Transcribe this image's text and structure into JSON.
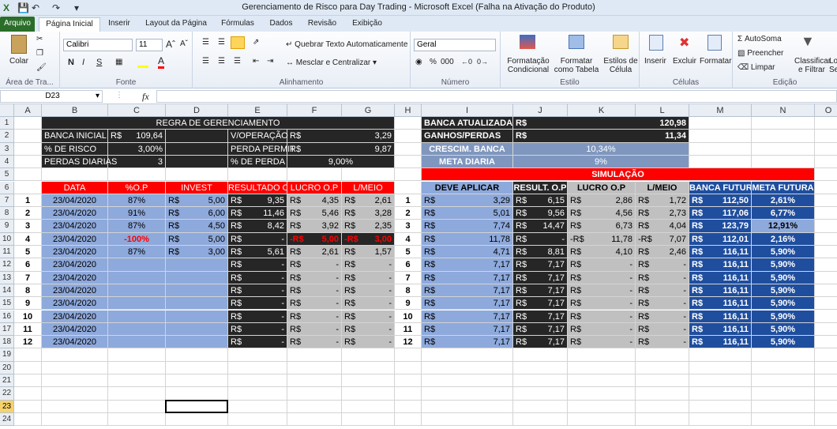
{
  "window": {
    "title": "Gerenciamento de Risco para Day Trading  -  Microsoft Excel (Falha na Ativação do Produto)"
  },
  "tabs": [
    "Arquivo",
    "Página Inicial",
    "Inserir",
    "Layout da Página",
    "Fórmulas",
    "Dados",
    "Revisão",
    "Exibição"
  ],
  "ribbon": {
    "clipboard": {
      "paste": "Colar",
      "label": "Área de Tra..."
    },
    "font": {
      "name": "Calibri",
      "size": "11",
      "bold": "N",
      "italic": "I",
      "underline": "S",
      "label": "Fonte"
    },
    "alignment": {
      "wrap": "Quebrar Texto Automaticamente",
      "merge": "Mesclar e Centralizar",
      "label": "Alinhamento"
    },
    "number": {
      "format": "Geral",
      "label": "Número"
    },
    "styles": {
      "conditional": "Formatação Condicional",
      "table": "Formatar como Tabela",
      "cell": "Estilos de Célula",
      "label": "Estilo"
    },
    "cells": {
      "insert": "Inserir",
      "delete": "Excluir",
      "format": "Formatar",
      "label": "Células"
    },
    "editing": {
      "autosum": "AutoSoma",
      "fill": "Preencher",
      "clear": "Limpar",
      "sort": "Classificar e Filtrar",
      "find": "Lo Se",
      "label": "Edição"
    }
  },
  "formula_bar": {
    "name_box": "D23",
    "fx": "fx",
    "value": ""
  },
  "columns": [
    "A",
    "B",
    "C",
    "D",
    "E",
    "F",
    "G",
    "H",
    "I",
    "J",
    "K",
    "L",
    "M",
    "N",
    "O"
  ],
  "rows": [
    "1",
    "2",
    "3",
    "4",
    "5",
    "6",
    "7",
    "8",
    "9",
    "10",
    "11",
    "12",
    "13",
    "14",
    "15",
    "16",
    "17",
    "18",
    "19",
    "20",
    "21",
    "22",
    "23",
    "24"
  ],
  "left_panel": {
    "title": "REGRA DE GERENCIAMENTO",
    "banca_inicial_label": "BANCA INICIAL",
    "banca_inicial_cur": "R$",
    "banca_inicial_val": "109,64",
    "risco_label": "% DE RISCO",
    "risco_val": "3,00%",
    "perdas_label": "PERDAS DIARIAS",
    "perdas_val": "3",
    "voperacao_label": "V/OPERAÇÃO",
    "voperacao_cur": "R$",
    "voperacao_val": "3,29",
    "perda_permit_label": "PERDA PERMIT",
    "perda_permit_cur": "R$",
    "perda_permit_val": "9,87",
    "pct_perda_label": "% DE PERDA",
    "pct_perda_val": "9,00%"
  },
  "right_panel": {
    "banca_atual_label": "BANCA ATUALIZADA",
    "banca_atual_cur": "R$",
    "banca_atual_val": "120,98",
    "ganhos_label": "GANHOS/PERDAS",
    "ganhos_cur": "R$",
    "ganhos_val": "11,34",
    "crescim_label": "CRESCIM. BANCA",
    "crescim_val": "10,34%",
    "meta_label": "META DIARIA",
    "meta_val": "9%",
    "simulacao_label": "SIMULAÇÃO"
  },
  "left_table": {
    "headers": [
      "DATA",
      "%O.P",
      "INVEST",
      "RESULTADO O.P",
      "LUCRO O.P",
      "L/MEIO"
    ],
    "rows": [
      {
        "n": "1",
        "data": "23/04/2020",
        "op": "87%",
        "inv_cur": "R$",
        "inv": "5,00",
        "res_cur": "R$",
        "res": "9,35",
        "luc_cur": "R$",
        "luc": "4,35",
        "mei_cur": "R$",
        "mei": "2,61"
      },
      {
        "n": "2",
        "data": "23/04/2020",
        "op": "91%",
        "inv_cur": "R$",
        "inv": "6,00",
        "res_cur": "R$",
        "res": "11,46",
        "luc_cur": "R$",
        "luc": "5,46",
        "mei_cur": "R$",
        "mei": "3,28"
      },
      {
        "n": "3",
        "data": "23/04/2020",
        "op": "87%",
        "inv_cur": "R$",
        "inv": "4,50",
        "res_cur": "R$",
        "res": "8,42",
        "luc_cur": "R$",
        "luc": "3,92",
        "mei_cur": "R$",
        "mei": "2,35"
      },
      {
        "n": "4",
        "data": "23/04/2020",
        "op": "-100%",
        "inv_cur": "R$",
        "inv": "5,00",
        "res_cur": "R$",
        "res": "-",
        "luc_cur": "-R$",
        "luc": "5,00",
        "mei_cur": "-R$",
        "mei": "3,00"
      },
      {
        "n": "5",
        "data": "23/04/2020",
        "op": "87%",
        "inv_cur": "R$",
        "inv": "3,00",
        "res_cur": "R$",
        "res": "5,61",
        "luc_cur": "R$",
        "luc": "2,61",
        "mei_cur": "R$",
        "mei": "1,57"
      },
      {
        "n": "6",
        "data": "23/04/2020",
        "op": "",
        "inv_cur": "",
        "inv": "",
        "res_cur": "R$",
        "res": "-",
        "luc_cur": "R$",
        "luc": "-",
        "mei_cur": "R$",
        "mei": "-"
      },
      {
        "n": "7",
        "data": "23/04/2020",
        "op": "",
        "inv_cur": "",
        "inv": "",
        "res_cur": "R$",
        "res": "-",
        "luc_cur": "R$",
        "luc": "-",
        "mei_cur": "R$",
        "mei": "-"
      },
      {
        "n": "8",
        "data": "23/04/2020",
        "op": "",
        "inv_cur": "",
        "inv": "",
        "res_cur": "R$",
        "res": "-",
        "luc_cur": "R$",
        "luc": "-",
        "mei_cur": "R$",
        "mei": "-"
      },
      {
        "n": "9",
        "data": "23/04/2020",
        "op": "",
        "inv_cur": "",
        "inv": "",
        "res_cur": "R$",
        "res": "-",
        "luc_cur": "R$",
        "luc": "-",
        "mei_cur": "R$",
        "mei": "-"
      },
      {
        "n": "10",
        "data": "23/04/2020",
        "op": "",
        "inv_cur": "",
        "inv": "",
        "res_cur": "R$",
        "res": "-",
        "luc_cur": "R$",
        "luc": "-",
        "mei_cur": "R$",
        "mei": "-"
      },
      {
        "n": "11",
        "data": "23/04/2020",
        "op": "",
        "inv_cur": "",
        "inv": "",
        "res_cur": "R$",
        "res": "-",
        "luc_cur": "R$",
        "luc": "-",
        "mei_cur": "R$",
        "mei": "-"
      },
      {
        "n": "12",
        "data": "23/04/2020",
        "op": "",
        "inv_cur": "",
        "inv": "",
        "res_cur": "R$",
        "res": "-",
        "luc_cur": "R$",
        "luc": "-",
        "mei_cur": "R$",
        "mei": "-"
      }
    ]
  },
  "right_table": {
    "headers": [
      "DEVE APLICAR",
      "RESULT. O.P",
      "LUCRO O.P",
      "L/MEIO",
      "BANCA FUTURA",
      "META FUTURA"
    ],
    "rows": [
      {
        "n": "1",
        "dev_cur": "R$",
        "dev": "3,29",
        "res_cur": "R$",
        "res": "6,15",
        "luc_cur": "R$",
        "luc": "2,86",
        "mei_cur": "R$",
        "mei": "1,72",
        "ban_cur": "R$",
        "ban": "112,50",
        "meta": "2,61%"
      },
      {
        "n": "2",
        "dev_cur": "R$",
        "dev": "5,01",
        "res_cur": "R$",
        "res": "9,56",
        "luc_cur": "R$",
        "luc": "4,56",
        "mei_cur": "R$",
        "mei": "2,73",
        "ban_cur": "R$",
        "ban": "117,06",
        "meta": "6,77%"
      },
      {
        "n": "3",
        "dev_cur": "R$",
        "dev": "7,74",
        "res_cur": "R$",
        "res": "14,47",
        "luc_cur": "R$",
        "luc": "6,73",
        "mei_cur": "R$",
        "mei": "4,04",
        "ban_cur": "R$",
        "ban": "123,79",
        "meta": "12,91%"
      },
      {
        "n": "4",
        "dev_cur": "R$",
        "dev": "11,78",
        "res_cur": "R$",
        "res": "-",
        "luc_cur": "-R$",
        "luc": "11,78",
        "mei_cur": "-R$",
        "mei": "7,07",
        "ban_cur": "R$",
        "ban": "112,01",
        "meta": "2,16%"
      },
      {
        "n": "5",
        "dev_cur": "R$",
        "dev": "4,71",
        "res_cur": "R$",
        "res": "8,81",
        "luc_cur": "R$",
        "luc": "4,10",
        "mei_cur": "R$",
        "mei": "2,46",
        "ban_cur": "R$",
        "ban": "116,11",
        "meta": "5,90%"
      },
      {
        "n": "6",
        "dev_cur": "R$",
        "dev": "7,17",
        "res_cur": "R$",
        "res": "7,17",
        "luc_cur": "R$",
        "luc": "-",
        "mei_cur": "R$",
        "mei": "-",
        "ban_cur": "R$",
        "ban": "116,11",
        "meta": "5,90%"
      },
      {
        "n": "7",
        "dev_cur": "R$",
        "dev": "7,17",
        "res_cur": "R$",
        "res": "7,17",
        "luc_cur": "R$",
        "luc": "-",
        "mei_cur": "R$",
        "mei": "-",
        "ban_cur": "R$",
        "ban": "116,11",
        "meta": "5,90%"
      },
      {
        "n": "8",
        "dev_cur": "R$",
        "dev": "7,17",
        "res_cur": "R$",
        "res": "7,17",
        "luc_cur": "R$",
        "luc": "-",
        "mei_cur": "R$",
        "mei": "-",
        "ban_cur": "R$",
        "ban": "116,11",
        "meta": "5,90%"
      },
      {
        "n": "9",
        "dev_cur": "R$",
        "dev": "7,17",
        "res_cur": "R$",
        "res": "7,17",
        "luc_cur": "R$",
        "luc": "-",
        "mei_cur": "R$",
        "mei": "-",
        "ban_cur": "R$",
        "ban": "116,11",
        "meta": "5,90%"
      },
      {
        "n": "10",
        "dev_cur": "R$",
        "dev": "7,17",
        "res_cur": "R$",
        "res": "7,17",
        "luc_cur": "R$",
        "luc": "-",
        "mei_cur": "R$",
        "mei": "-",
        "ban_cur": "R$",
        "ban": "116,11",
        "meta": "5,90%"
      },
      {
        "n": "11",
        "dev_cur": "R$",
        "dev": "7,17",
        "res_cur": "R$",
        "res": "7,17",
        "luc_cur": "R$",
        "luc": "-",
        "mei_cur": "R$",
        "mei": "-",
        "ban_cur": "R$",
        "ban": "116,11",
        "meta": "5,90%"
      },
      {
        "n": "12",
        "dev_cur": "R$",
        "dev": "7,17",
        "res_cur": "R$",
        "res": "7,17",
        "luc_cur": "R$",
        "luc": "-",
        "mei_cur": "R$",
        "mei": "-",
        "ban_cur": "R$",
        "ban": "116,11",
        "meta": "5,90%"
      }
    ]
  },
  "icons": {
    "save": "save-icon",
    "undo": "undo-icon",
    "redo": "redo-icon",
    "sum": "Σ",
    "fx": "fx"
  },
  "colors": {
    "dark": "#262626",
    "gray": "#c0c0c0",
    "blue": "#8ea9db",
    "red": "#ff0000",
    "navy": "#1f4e9e",
    "file_tab": "#2a6e2a"
  }
}
